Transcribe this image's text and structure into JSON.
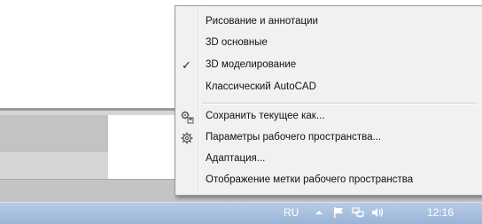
{
  "menu": {
    "items": [
      {
        "label": "Рисование и аннотации",
        "checked": false
      },
      {
        "label": "3D основные",
        "checked": false
      },
      {
        "label": "3D моделирование",
        "checked": true
      },
      {
        "label": "Классический AutoCAD",
        "checked": false
      }
    ],
    "check_mark": "✓",
    "save_current_as": {
      "label": "Сохранить текущее как...",
      "icon": "save-workspace-icon"
    },
    "workspace_settings": {
      "label": "Параметры рабочего пространства...",
      "icon": "gear-icon"
    },
    "customize": {
      "label": "Адаптация..."
    },
    "display_workspace_label": {
      "label": "Отображение метки рабочего пространства"
    }
  },
  "taskbar": {
    "language": "RU",
    "clock": "12:16",
    "tray_icons": [
      "show-hidden-icons-icon",
      "action-center-flag-icon",
      "network-icon",
      "volume-icon"
    ]
  },
  "colors": {
    "menu_background": "#f1f1f1",
    "menu_border": "#9a9a9a",
    "taskbar": "#a9c0de"
  }
}
